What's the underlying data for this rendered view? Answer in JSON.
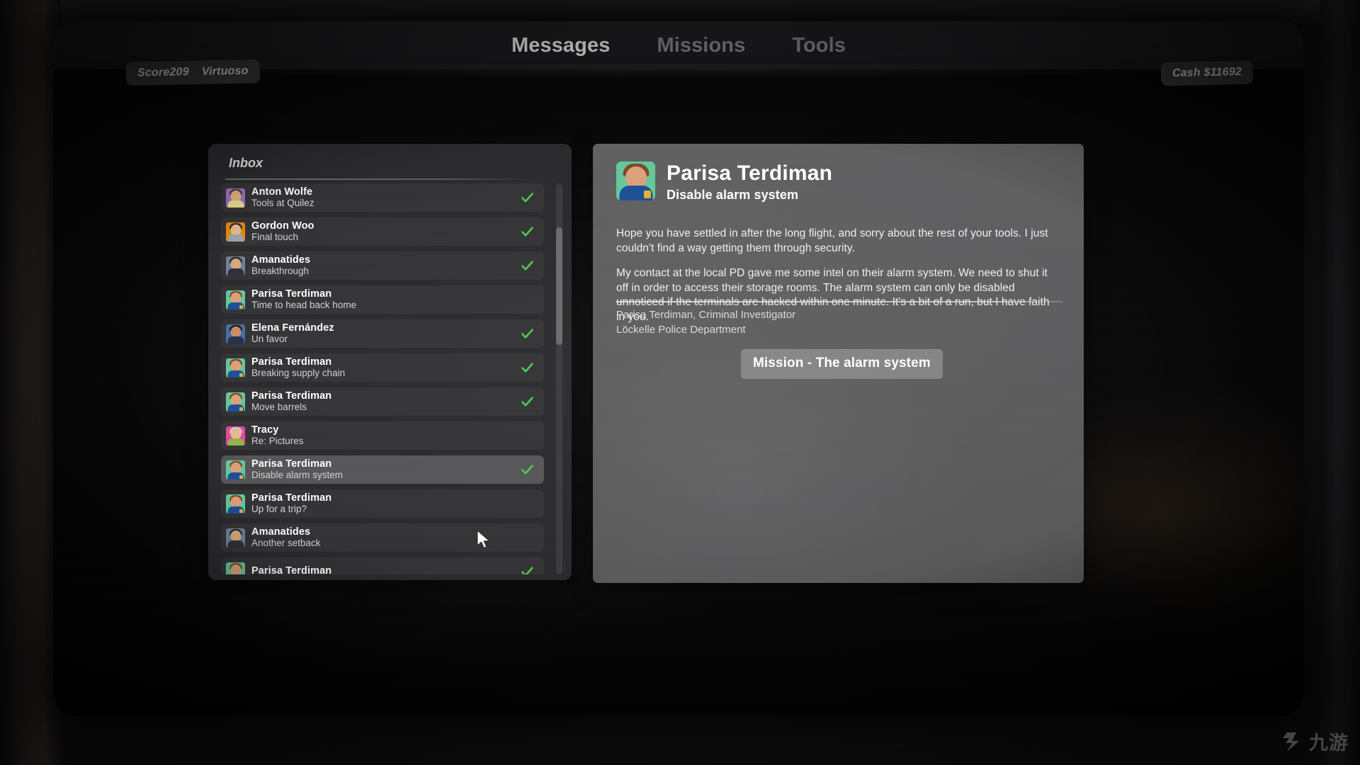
{
  "topbar": {
    "score_label": "Score209",
    "rank_label": "Virtuoso",
    "cash_label": "Cash $11692",
    "tabs": [
      {
        "label": "Messages",
        "active": true
      },
      {
        "label": "Missions",
        "active": false
      },
      {
        "label": "Tools",
        "active": false
      }
    ]
  },
  "inbox": {
    "title": "Inbox",
    "messages": [
      {
        "from": "Anton Wolfe",
        "subject": "Tools at Quilez",
        "read": true,
        "selected": false,
        "avatar": {
          "bg": "#9b6fc4",
          "hair": "#4a3a2c",
          "body": "#e8d98a",
          "skin": "#dcae84",
          "badge": false
        }
      },
      {
        "from": "Gordon Woo",
        "subject": "Final touch",
        "read": true,
        "selected": false,
        "avatar": {
          "bg": "#e2880f",
          "hair": "#2f2a26",
          "body": "#9aa4ae",
          "skin": "#e0bb90",
          "badge": false
        }
      },
      {
        "from": "Amanatides",
        "subject": "Breakthrough",
        "read": true,
        "selected": false,
        "avatar": {
          "bg": "#6d8096",
          "hair": "#2b231c",
          "body": "#2e3038",
          "skin": "#d8a87e",
          "badge": false
        }
      },
      {
        "from": "Parisa Terdiman",
        "subject": "Time to head back home",
        "read": false,
        "selected": false,
        "avatar": {
          "bg": "#63c79a",
          "hair": "#7a4a28",
          "body": "#1d4f96",
          "skin": "#dba07a",
          "badge": true
        }
      },
      {
        "from": "Elena Fernández",
        "subject": "Un favor",
        "read": true,
        "selected": false,
        "avatar": {
          "bg": "#3f6fa8",
          "hair": "#1d1716",
          "body": "#23324a",
          "skin": "#c98b63",
          "badge": false
        }
      },
      {
        "from": "Parisa Terdiman",
        "subject": "Breaking supply chain",
        "read": true,
        "selected": false,
        "avatar": {
          "bg": "#63c79a",
          "hair": "#7a4a28",
          "body": "#1d4f96",
          "skin": "#dba07a",
          "badge": true
        }
      },
      {
        "from": "Parisa Terdiman",
        "subject": "Move barrels",
        "read": true,
        "selected": false,
        "avatar": {
          "bg": "#63c79a",
          "hair": "#7a4a28",
          "body": "#1d4f96",
          "skin": "#dba07a",
          "badge": true
        }
      },
      {
        "from": "Tracy",
        "subject": "Re: Pictures",
        "read": false,
        "selected": false,
        "avatar": {
          "bg": "#e0489c",
          "hair": "#c9c9cd",
          "body": "#97b04a",
          "skin": "#e3b892",
          "badge": false
        }
      },
      {
        "from": "Parisa Terdiman",
        "subject": "Disable alarm system",
        "read": true,
        "selected": true,
        "avatar": {
          "bg": "#63c79a",
          "hair": "#7a4a28",
          "body": "#1d4f96",
          "skin": "#dba07a",
          "badge": true
        }
      },
      {
        "from": "Parisa Terdiman",
        "subject": "Up for a trip?",
        "read": false,
        "selected": false,
        "avatar": {
          "bg": "#63c79a",
          "hair": "#7a4a28",
          "body": "#1d4f96",
          "skin": "#dba07a",
          "badge": true
        }
      },
      {
        "from": "Amanatides",
        "subject": "Another setback",
        "read": false,
        "selected": false,
        "avatar": {
          "bg": "#6d8096",
          "hair": "#2b231c",
          "body": "#2e3038",
          "skin": "#d8a87e",
          "badge": false
        }
      },
      {
        "from": "Parisa Terdiman",
        "subject": "",
        "read": true,
        "selected": false,
        "avatar": {
          "bg": "#63c79a",
          "hair": "#7a4a28",
          "body": "#1d4f96",
          "skin": "#dba07a",
          "badge": true
        }
      }
    ]
  },
  "detail": {
    "from": "Parisa Terdiman",
    "subject": "Disable alarm system",
    "avatar": {
      "bg": "#63c79a",
      "hair": "#7a4a28",
      "body": "#1d4f96",
      "skin": "#dba07a",
      "badge": true
    },
    "paragraphs": [
      "Hope you have settled in after the long flight, and sorry about the rest of your tools. I just couldn't find a way getting them through security.",
      "My contact at the local PD gave me some intel on their alarm system. We need to shut it off in order to access their storage rooms. The alarm system can only be disabled unnoticed if the terminals are hacked within one minute. It's a bit of a run, but I have faith in you."
    ],
    "signature_name": "Parisa Terdiman, Criminal Investigator",
    "signature_org": "Löckelle Police Department",
    "mission_button_label": "Mission - The alarm system"
  },
  "watermark": {
    "text": "九游"
  },
  "colors": {
    "check_green": "#4ec94e",
    "panel_dark": "#2c2c2f",
    "row_bg": "#333336",
    "row_selected": "#555558",
    "detail_panel": "#707072"
  }
}
